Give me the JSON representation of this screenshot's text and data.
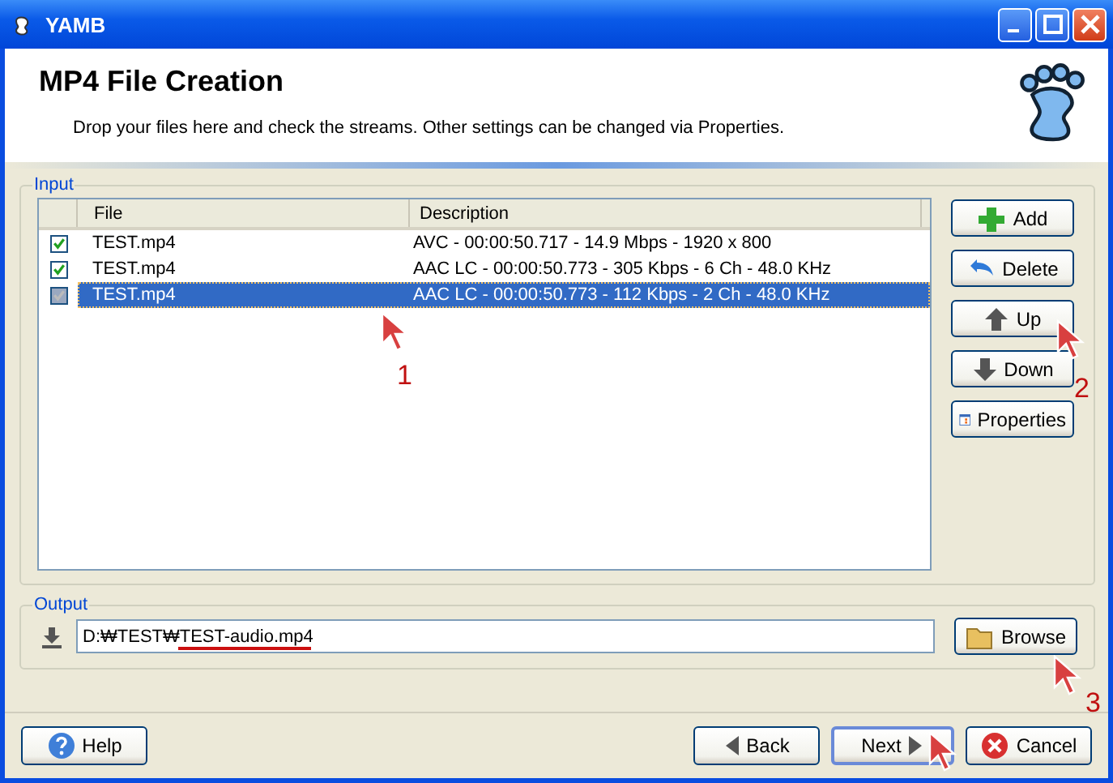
{
  "window": {
    "title": "YAMB"
  },
  "header": {
    "title": "MP4 File Creation",
    "subtitle": "Drop your files here and check the streams. Other settings can be changed via Properties."
  },
  "input": {
    "legend": "Input",
    "columns": [
      "File",
      "Description"
    ],
    "rows": [
      {
        "file": "TEST.mp4",
        "description": "AVC - 00:00:50.717 - 14.9 Mbps - 1920 x 800",
        "checked": true,
        "selected": false
      },
      {
        "file": "TEST.mp4",
        "description": "AAC LC - 00:00:50.773 - 305 Kbps - 6 Ch - 48.0 KHz",
        "checked": true,
        "selected": false
      },
      {
        "file": "TEST.mp4",
        "description": "AAC LC - 00:00:50.773 - 112 Kbps - 2 Ch - 48.0 KHz",
        "checked": true,
        "selected": true
      }
    ]
  },
  "side_buttons": [
    {
      "label": "Add",
      "kind": "add"
    },
    {
      "label": "Delete",
      "kind": "delete"
    },
    {
      "label": "Up",
      "kind": "up"
    },
    {
      "label": "Down",
      "kind": "down"
    },
    {
      "label": "Properties",
      "kind": "properties"
    }
  ],
  "output": {
    "legend": "Output",
    "value": "D:₩TEST₩TEST-audio.mp4",
    "browse": "Browse"
  },
  "footer_buttons": [
    {
      "label": "Help",
      "kind": "help"
    },
    {
      "label": "Back",
      "kind": "back"
    },
    {
      "label": "Next",
      "kind": "next"
    },
    {
      "label": "Cancel",
      "kind": "cancel"
    }
  ],
  "annotations": [
    "1",
    "2",
    "3"
  ]
}
